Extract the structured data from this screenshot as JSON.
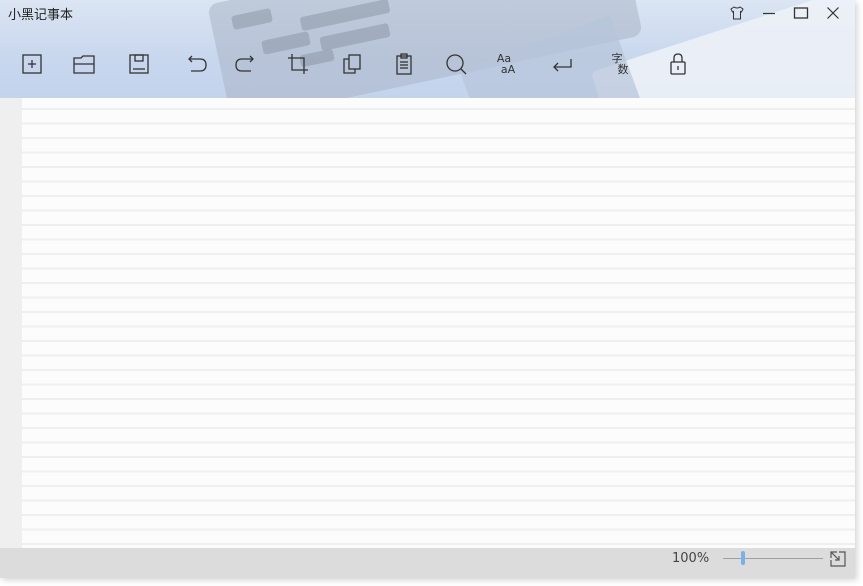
{
  "app": {
    "title": "小黑记事本"
  },
  "window_controls": [
    {
      "icon": "skin-icon"
    },
    {
      "icon": "minimize-icon"
    },
    {
      "icon": "maximize-icon"
    },
    {
      "icon": "close-icon"
    }
  ],
  "toolbar": {
    "tools": [
      {
        "icon": "new-file-icon"
      },
      {
        "icon": "open-folder-icon"
      },
      {
        "icon": "save-icon"
      },
      {
        "icon": "undo-icon"
      },
      {
        "icon": "redo-icon"
      },
      {
        "icon": "crop-icon"
      },
      {
        "icon": "copy-icon"
      },
      {
        "icon": "paste-icon"
      },
      {
        "icon": "search-icon"
      },
      {
        "icon": "replace-icon",
        "label_top": "Aa",
        "label_bottom": "aA"
      },
      {
        "icon": "word-wrap-icon"
      },
      {
        "icon": "word-count-icon",
        "label_top": "字",
        "label_bottom": "数"
      },
      {
        "icon": "lock-icon"
      }
    ]
  },
  "editor": {
    "content": ""
  },
  "status": {
    "zoom_label": "100%",
    "zoom_level": 0.2,
    "accent_color": "#7ab1e8"
  }
}
